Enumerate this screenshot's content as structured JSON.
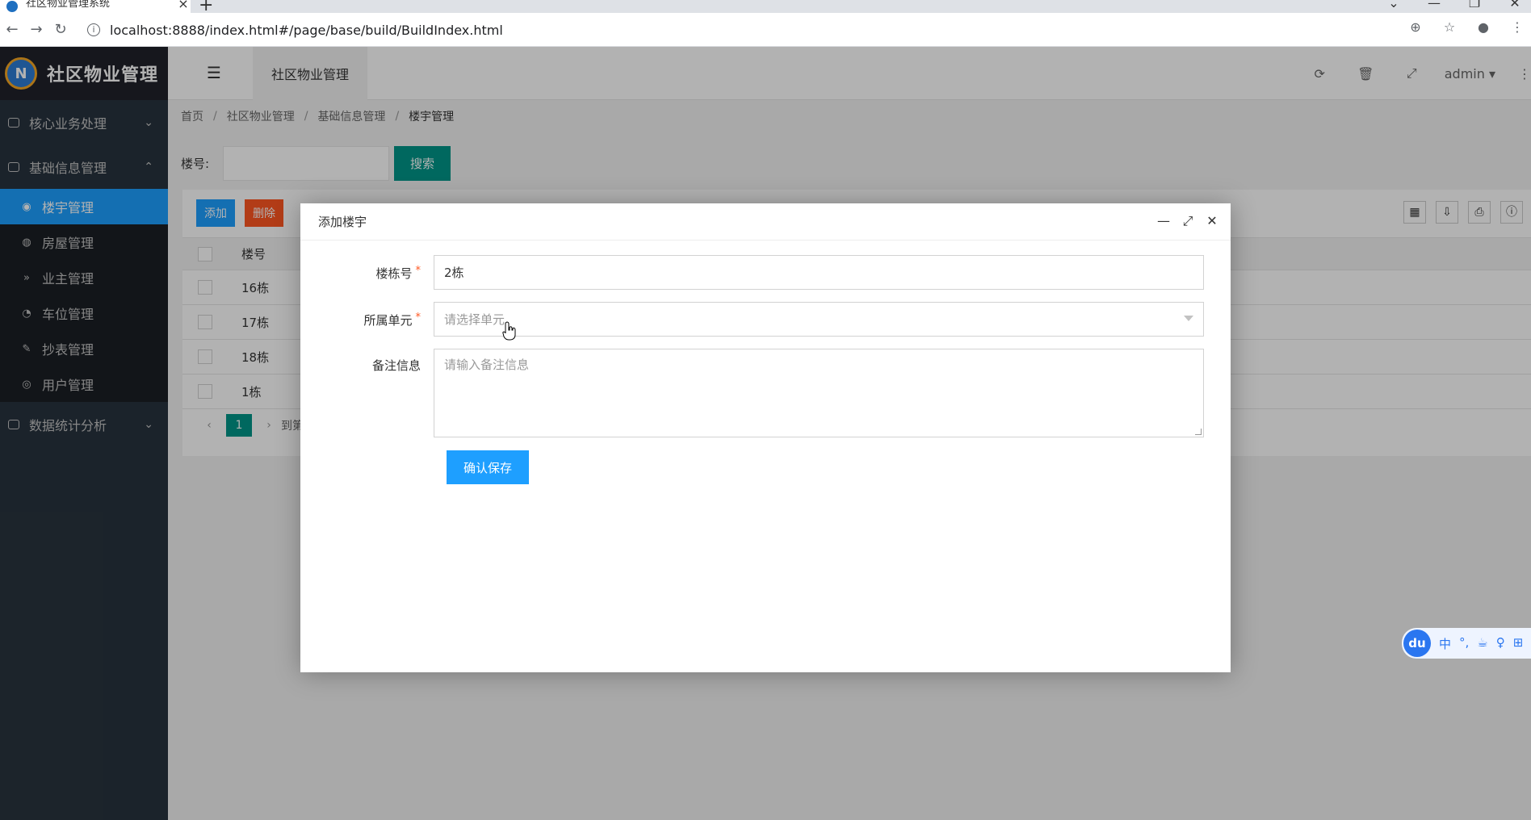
{
  "browser": {
    "tab_title": "社区物业管理系统",
    "tab_close": "×",
    "new_tab": "+",
    "url": "localhost:8888/index.html#/page/base/build/BuildIndex.html",
    "info_glyph": "i",
    "back_glyph": "←",
    "forward_glyph": "→",
    "reload_glyph": "↻",
    "window_controls": [
      "⌄",
      "—",
      "❐",
      "✕"
    ],
    "addr_actions": [
      "⊕",
      "☆",
      "●",
      "⋮"
    ]
  },
  "sidebar": {
    "logo_mark": "N",
    "logo_text": "社区物业管理",
    "groups": [
      {
        "label": "核心业务处理",
        "chevron": "⌄"
      },
      {
        "label": "基础信息管理",
        "chevron": "⌃"
      },
      {
        "label": "数据统计分析",
        "chevron": "⌄"
      }
    ],
    "items": [
      {
        "label": "楼宇管理",
        "icon": "◉"
      },
      {
        "label": "房屋管理",
        "icon": "◍"
      },
      {
        "label": "业主管理",
        "icon": "»"
      },
      {
        "label": "车位管理",
        "icon": "◔"
      },
      {
        "label": "抄表管理",
        "icon": "✎"
      },
      {
        "label": "用户管理",
        "icon": "◎"
      }
    ]
  },
  "header": {
    "flex_glyph": "☰",
    "module_tab": "社区物业管理",
    "icons": [
      "⟳",
      "🗑",
      "⤢"
    ],
    "user": "admin ▾",
    "more": "⋮"
  },
  "breadcrumb": {
    "items": [
      "首页",
      "社区物业管理",
      "基础信息管理",
      "楼宇管理"
    ],
    "sep": "/"
  },
  "search": {
    "label": "楼号:",
    "button": "搜索"
  },
  "table": {
    "add_label": "添加",
    "delete_label": "删除",
    "tool_icons": [
      "▦",
      "⇩",
      "⎙",
      "ⓘ"
    ],
    "header": "楼号",
    "rows": [
      "16栋",
      "17栋",
      "18栋",
      "1栋"
    ],
    "pager_prev": "‹",
    "pager_current": "1",
    "pager_next": "›",
    "pager_goto": "到第"
  },
  "modal": {
    "title": "添加楼宇",
    "ctrls": [
      "—",
      "⤢",
      "✕"
    ],
    "fields": {
      "building_label": "楼栋号",
      "building_value": "2栋",
      "unit_label": "所属单元",
      "unit_placeholder": "请选择单元",
      "note_label": "备注信息",
      "note_placeholder": "请输入备注信息"
    },
    "required_mark": "*",
    "save_label": "确认保存"
  },
  "ime": {
    "logo": "du",
    "items": [
      "中",
      "°,",
      "☕",
      "♀",
      "⊞"
    ]
  }
}
